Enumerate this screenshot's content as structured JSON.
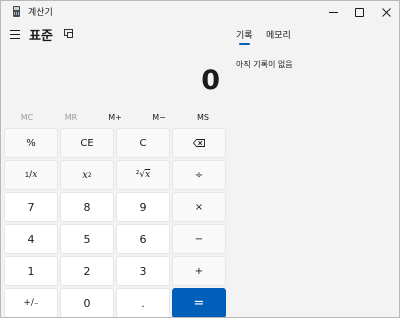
{
  "window": {
    "title": "계산기"
  },
  "header": {
    "mode_title": "표준"
  },
  "display": {
    "value": "0"
  },
  "memory": {
    "buttons": [
      {
        "label": "MC",
        "enabled": false
      },
      {
        "label": "MR",
        "enabled": false
      },
      {
        "label": "M+",
        "enabled": true
      },
      {
        "label": "M−",
        "enabled": true
      },
      {
        "label": "MS",
        "enabled": true
      }
    ]
  },
  "keypad": {
    "percent": "%",
    "ce": "CE",
    "clear": "C",
    "divide": "÷",
    "multiply": "×",
    "subtract": "−",
    "add": "+",
    "equals": "=",
    "negate": "+/₋",
    "decimal": ".",
    "reciprocal_num": "1",
    "reciprocal_den": "x",
    "square_base": "x",
    "square_exp": "2",
    "sqrt_prefix": "²√",
    "sqrt_var": "x",
    "digits": [
      "0",
      "1",
      "2",
      "3",
      "4",
      "5",
      "6",
      "7",
      "8",
      "9"
    ]
  },
  "history_panel": {
    "tabs": [
      {
        "label": "기록",
        "active": true
      },
      {
        "label": "메모리",
        "active": false
      }
    ],
    "empty_message": "아직 기록이 없음"
  },
  "colors": {
    "accent": "#005fb8",
    "background": "#f3f3f3",
    "number_key": "#ffffff",
    "function_key": "#f9f9f9"
  }
}
